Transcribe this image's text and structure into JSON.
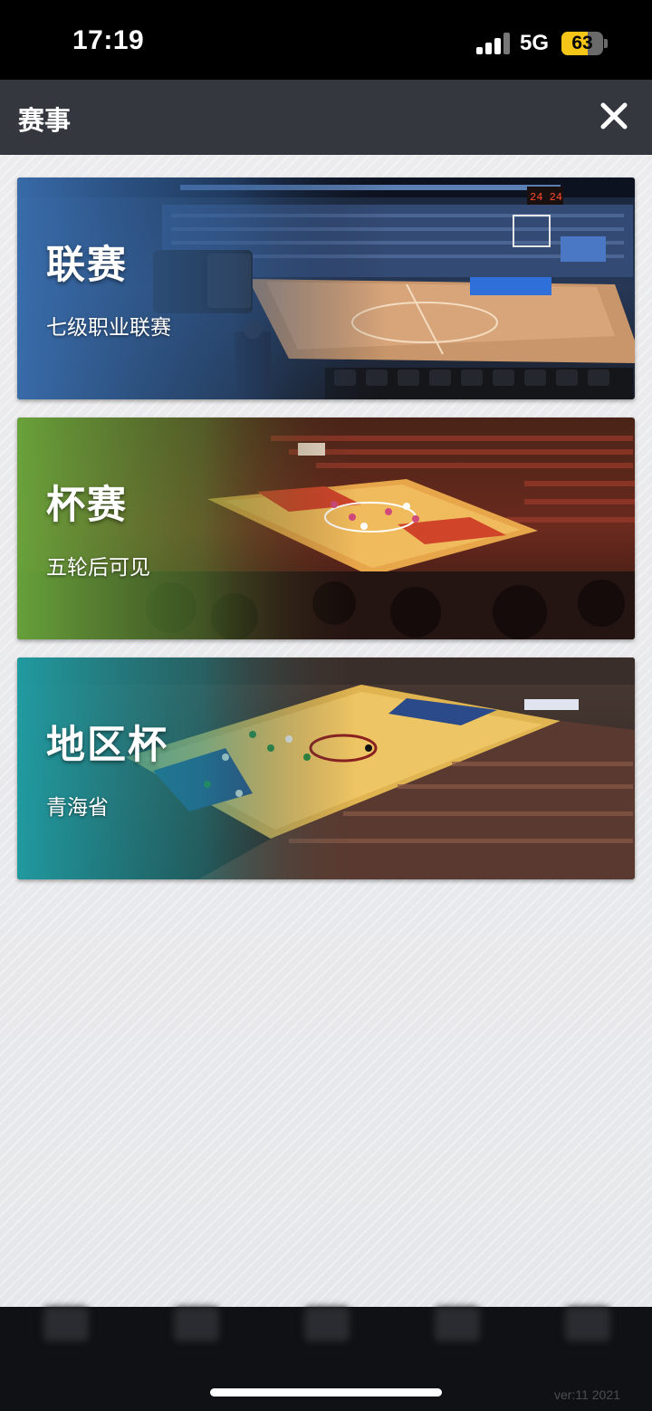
{
  "status_bar": {
    "time": "17:19",
    "network": "5G",
    "battery": "63",
    "battery_level": 0.63
  },
  "header": {
    "title": "赛事",
    "close_icon": "close-icon"
  },
  "cards": [
    {
      "title": "联赛",
      "subtitle": "七级职业联赛",
      "accent": "#3a6fb0"
    },
    {
      "title": "杯赛",
      "subtitle": "五轮后可见",
      "accent": "#6aa83c"
    },
    {
      "title": "地区杯",
      "subtitle": "青海省",
      "accent": "#1fa0a6"
    }
  ],
  "tabbar": {
    "tabs": [
      {
        "icon": "tab-icon-1"
      },
      {
        "icon": "tab-icon-2"
      },
      {
        "icon": "tab-icon-3"
      },
      {
        "icon": "tab-icon-4"
      },
      {
        "icon": "tab-icon-5"
      }
    ],
    "version": "ver:11  2021"
  }
}
